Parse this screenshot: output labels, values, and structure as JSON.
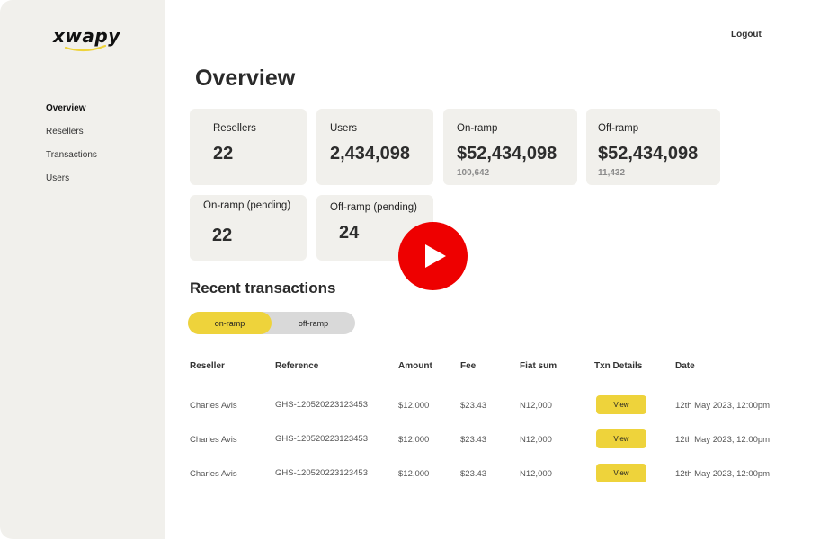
{
  "brand": {
    "name": "xwapy",
    "accent": "#eed33b"
  },
  "sidebar": {
    "items": [
      {
        "label": "Overview",
        "active": true
      },
      {
        "label": "Resellers",
        "active": false
      },
      {
        "label": "Transactions",
        "active": false
      },
      {
        "label": "Users",
        "active": false
      }
    ]
  },
  "header": {
    "logout_label": "Logout"
  },
  "overview": {
    "title": "Overview",
    "cards": [
      {
        "label": "Resellers",
        "value": "22"
      },
      {
        "label": "Users",
        "value": "2,434,098"
      },
      {
        "label": "On-ramp",
        "value": "$52,434,098",
        "sub": "100,642"
      },
      {
        "label": "Off-ramp",
        "value": "$52,434,098",
        "sub": "11,432"
      },
      {
        "label": "On-ramp (pending)",
        "value": "22"
      },
      {
        "label": "Off-ramp (pending)",
        "value": "24"
      }
    ]
  },
  "recent": {
    "title": "Recent transactions",
    "tabs": [
      {
        "label": "on-ramp",
        "active": true
      },
      {
        "label": "off-ramp",
        "active": false
      }
    ],
    "columns": [
      "Reseller",
      "Reference",
      "Amount",
      "Fee",
      "Fiat sum",
      "Txn Details",
      "Date"
    ],
    "rows": [
      {
        "reseller": "Charles Avis",
        "reference": "GHS-120520223123453",
        "amount": "$12,000",
        "fee": "$23.43",
        "fiat": "N12,000",
        "action": "View",
        "date": "12th May 2023, 12:00pm"
      },
      {
        "reseller": "Charles Avis",
        "reference": "GHS-120520223123453",
        "amount": "$12,000",
        "fee": "$23.43",
        "fiat": "N12,000",
        "action": "View",
        "date": "12th May 2023, 12:00pm"
      },
      {
        "reseller": "Charles Avis",
        "reference": "GHS-120520223123453",
        "amount": "$12,000",
        "fee": "$23.43",
        "fiat": "N12,000",
        "action": "View",
        "date": "12th May 2023, 12:00pm"
      }
    ]
  },
  "overlay": {
    "icon": "play-icon",
    "color": "#ee0000"
  }
}
